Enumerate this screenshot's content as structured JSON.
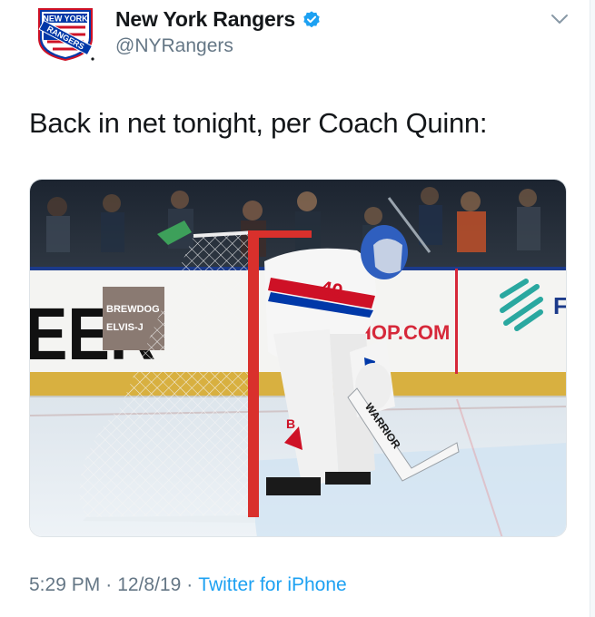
{
  "account": {
    "display_name": "New York Rangers",
    "handle": "@NYRangers",
    "verified": true,
    "logo_text_top": "NEW YORK",
    "logo_text_band": "RANGERS"
  },
  "tweet": {
    "text": "Back in net tonight, per Coach Quinn:",
    "time": "5:29 PM",
    "separator": "·",
    "date": "12/8/19",
    "source": "Twitter for iPhone"
  },
  "media": {
    "board_text_left": "EER",
    "board_text_shop": "HOP.COM",
    "sponsor_text_1": "BREWDOG",
    "sponsor_text_2": "ELVIS-J",
    "jersey_number": "40",
    "stick_brand": "WARRIOR",
    "pad_brand": "B"
  },
  "colors": {
    "brand_blue": "#0038a8",
    "brand_red": "#ce1126",
    "link": "#1da1f2",
    "muted": "#657786"
  }
}
